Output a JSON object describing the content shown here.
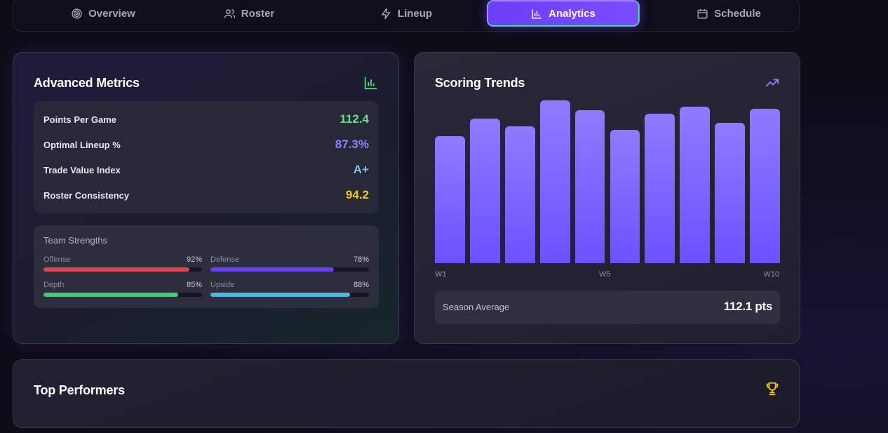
{
  "nav": {
    "tabs": [
      {
        "label": "Overview",
        "icon": "target-icon",
        "active": false
      },
      {
        "label": "Roster",
        "icon": "users-icon",
        "active": false
      },
      {
        "label": "Lineup",
        "icon": "lightning-icon",
        "active": false
      },
      {
        "label": "Analytics",
        "icon": "bar-chart-icon",
        "active": true
      },
      {
        "label": "Schedule",
        "icon": "calendar-icon",
        "active": false
      }
    ]
  },
  "metrics": {
    "title": "Advanced Metrics",
    "icon": "bar-chart-icon",
    "accent": "#4ade80",
    "rows": [
      {
        "label": "Points Per Game",
        "value": "112.4",
        "color": "#6cdc8e"
      },
      {
        "label": "Optimal Lineup %",
        "value": "87.3%",
        "color": "#8b84ff"
      },
      {
        "label": "Trade Value Index",
        "value": "A+",
        "color": "#7cc4e8"
      },
      {
        "label": "Roster Consistency",
        "value": "94.2",
        "color": "#f5c518"
      }
    ],
    "strengths": {
      "title": "Team Strengths",
      "items": [
        {
          "label": "Offense",
          "pct_label": "92%",
          "pct": 92,
          "color": "#e0454f"
        },
        {
          "label": "Defense",
          "pct_label": "78%",
          "pct": 78,
          "color": "#6a3ff7"
        },
        {
          "label": "Depth",
          "pct_label": "85%",
          "pct": 85,
          "color": "#4cc777"
        },
        {
          "label": "Upside",
          "pct_label": "88%",
          "pct": 88,
          "color": "#56b4e3"
        }
      ]
    }
  },
  "trends": {
    "title": "Scoring Trends",
    "icon": "trending-up-icon",
    "x_labels": [
      {
        "text": "W1",
        "index": 0
      },
      {
        "text": "W5",
        "index": 4
      },
      {
        "text": "W10",
        "index": 9
      }
    ],
    "bar_values": [
      0.78,
      0.89,
      0.84,
      1.0,
      0.94,
      0.82,
      0.92,
      0.96,
      0.86,
      0.95
    ],
    "average_label": "Season Average",
    "average_value": "112.1 pts"
  },
  "top": {
    "title": "Top Performers",
    "icon": "trophy-icon",
    "accent": "#f5c518"
  }
}
